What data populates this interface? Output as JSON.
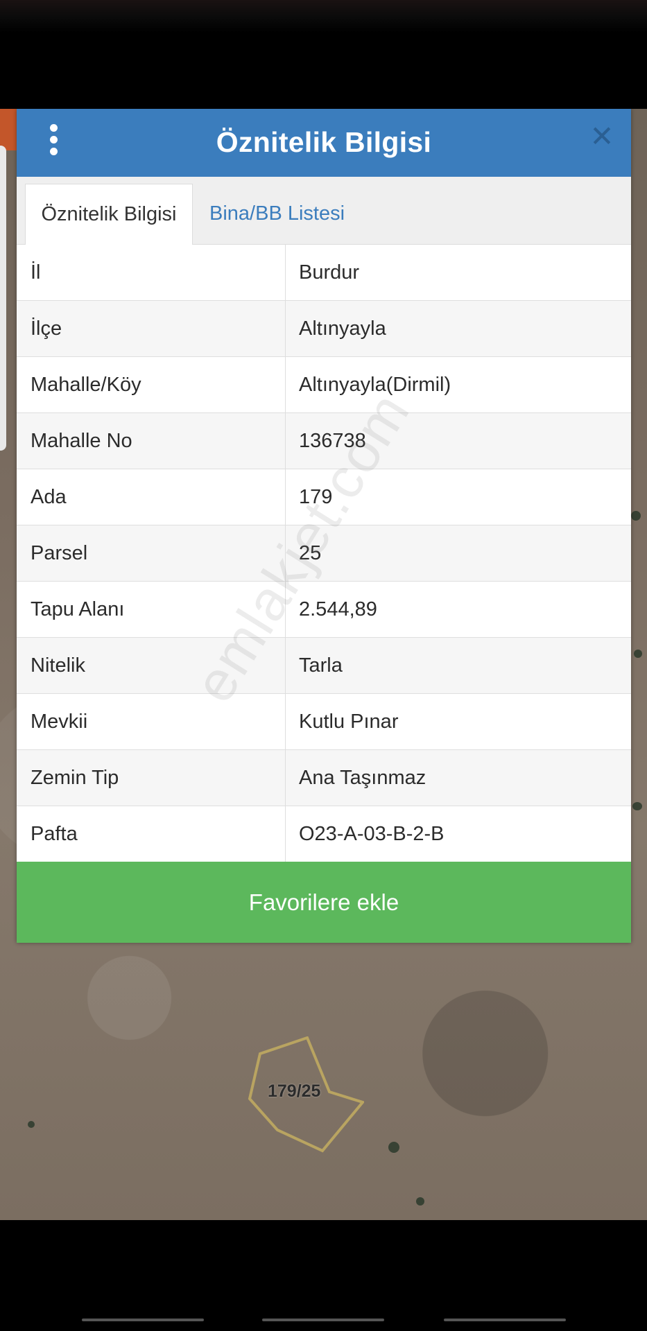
{
  "header": {
    "title": "Öznitelik Bilgisi",
    "close_symbol": "✕"
  },
  "tabs": [
    {
      "label": "Öznitelik Bilgisi",
      "active": true
    },
    {
      "label": "Bina/BB Listesi",
      "active": false
    }
  ],
  "attributes": [
    {
      "key": "İl",
      "value": "Burdur"
    },
    {
      "key": "İlçe",
      "value": "Altınyayla"
    },
    {
      "key": "Mahalle/Köy",
      "value": "Altınyayla(Dirmil)"
    },
    {
      "key": "Mahalle No",
      "value": "136738"
    },
    {
      "key": "Ada",
      "value": "179"
    },
    {
      "key": "Parsel",
      "value": "25"
    },
    {
      "key": "Tapu Alanı",
      "value": "2.544,89"
    },
    {
      "key": "Nitelik",
      "value": "Tarla"
    },
    {
      "key": "Mevkii",
      "value": "Kutlu Pınar"
    },
    {
      "key": "Zemin Tip",
      "value": "Ana Taşınmaz"
    },
    {
      "key": "Pafta",
      "value": "O23-A-03-B-2-B"
    }
  ],
  "favorite_button": "Favorilere ekle",
  "watermark": "emlakjet.com",
  "map": {
    "parcel_label": "179/25"
  },
  "colors": {
    "header": "#3b7dbd",
    "accent_link": "#3b7dbd",
    "favorite": "#5cb85c"
  },
  "icons": {
    "menu": "kebab-menu-icon",
    "close": "close-icon"
  }
}
